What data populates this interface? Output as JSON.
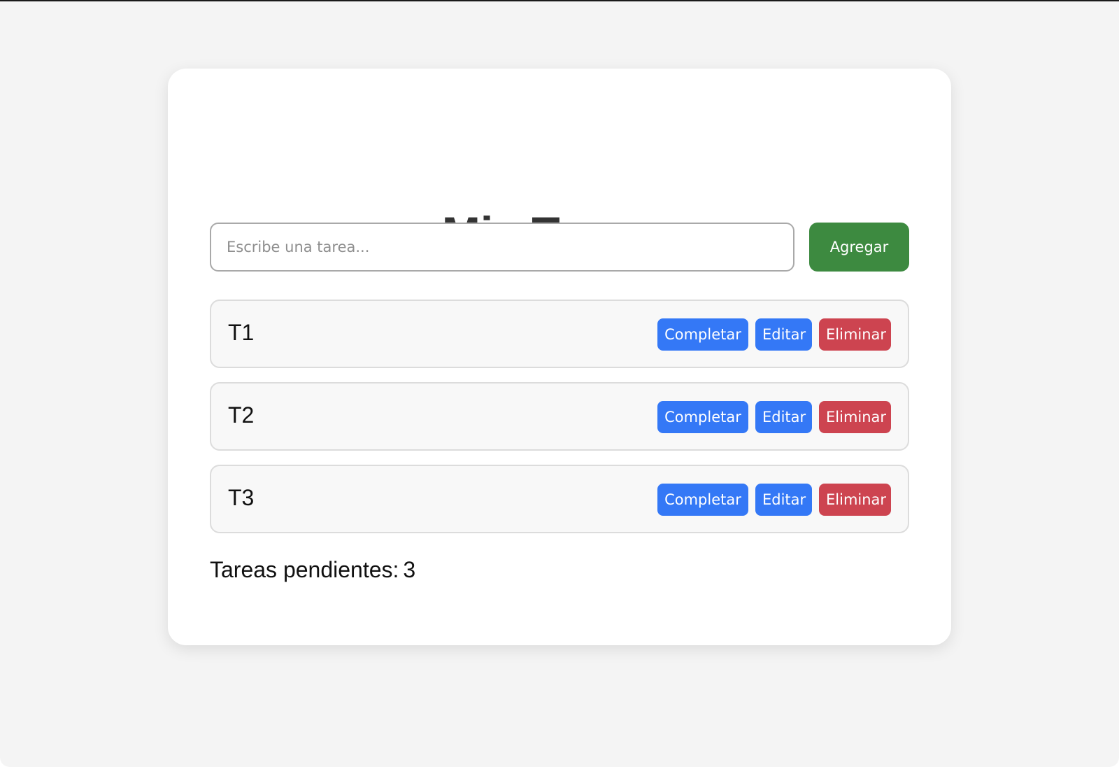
{
  "app": {
    "title": "Mis Tareas"
  },
  "add_form": {
    "input_value": "",
    "input_placeholder": "Escribe una tarea...",
    "add_label": "Agregar"
  },
  "tasks": [
    {
      "name": "T1",
      "complete_label": "Completar",
      "edit_label": "Editar",
      "delete_label": "Eliminar"
    },
    {
      "name": "T2",
      "complete_label": "Completar",
      "edit_label": "Editar",
      "delete_label": "Eliminar"
    },
    {
      "name": "T3",
      "complete_label": "Completar",
      "edit_label": "Editar",
      "delete_label": "Eliminar"
    }
  ],
  "footer": {
    "pending_label": "Tareas pendientes:",
    "pending_count": "3"
  },
  "colors": {
    "page_background": "#f4f4f4",
    "card_background": "#ffffff",
    "title": "#333333",
    "add_button": "#3d8a40",
    "primary_action": "#3478f6",
    "danger_action": "#cd4450",
    "task_background": "#f8f8f8",
    "task_border": "#dcdcdc"
  }
}
